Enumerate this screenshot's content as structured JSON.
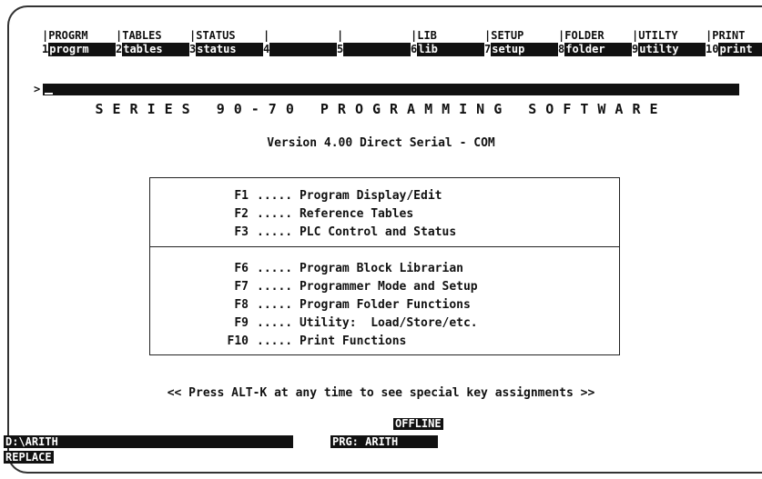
{
  "function_keys": [
    {
      "top": "|PROGRM",
      "num": "1",
      "label": "progrm"
    },
    {
      "top": "|TABLES",
      "num": "2",
      "label": "tables"
    },
    {
      "top": "|STATUS",
      "num": "3",
      "label": "status"
    },
    {
      "top": "|",
      "num": "4",
      "label": ""
    },
    {
      "top": "|",
      "num": "5",
      "label": ""
    },
    {
      "top": "|LIB",
      "num": "6",
      "label": "lib"
    },
    {
      "top": "|SETUP",
      "num": "7",
      "label": "setup"
    },
    {
      "top": "|FOLDER",
      "num": "8",
      "label": "folder"
    },
    {
      "top": "|UTILTY",
      "num": "9",
      "label": "utilty"
    },
    {
      "top": "|PRINT",
      "num": "10",
      "label": "print"
    }
  ],
  "command": {
    "prompt": ">"
  },
  "header": {
    "title": "SERIES 90-70 PROGRAMMING SOFTWARE",
    "version": "Version 4.00 Direct Serial - COM"
  },
  "menu": {
    "group1": [
      {
        "key": "F1",
        "desc": "..... Program Display/Edit"
      },
      {
        "key": "F2",
        "desc": "..... Reference Tables"
      },
      {
        "key": "F3",
        "desc": "..... PLC Control and Status"
      }
    ],
    "group2": [
      {
        "key": "F6",
        "desc": "..... Program Block Librarian"
      },
      {
        "key": "F7",
        "desc": "..... Programmer Mode and Setup"
      },
      {
        "key": "F8",
        "desc": "..... Program Folder Functions"
      },
      {
        "key": "F9",
        "desc": "..... Utility:  Load/Store/etc."
      },
      {
        "key": "F10",
        "desc": "..... Print Functions"
      }
    ]
  },
  "hint": "<< Press ALT-K at any time to see special key assignments >>",
  "status": {
    "offline": "OFFLINE",
    "path": "D:\\ARITH",
    "program": "PRG: ARITH",
    "mode": "REPLACE"
  }
}
